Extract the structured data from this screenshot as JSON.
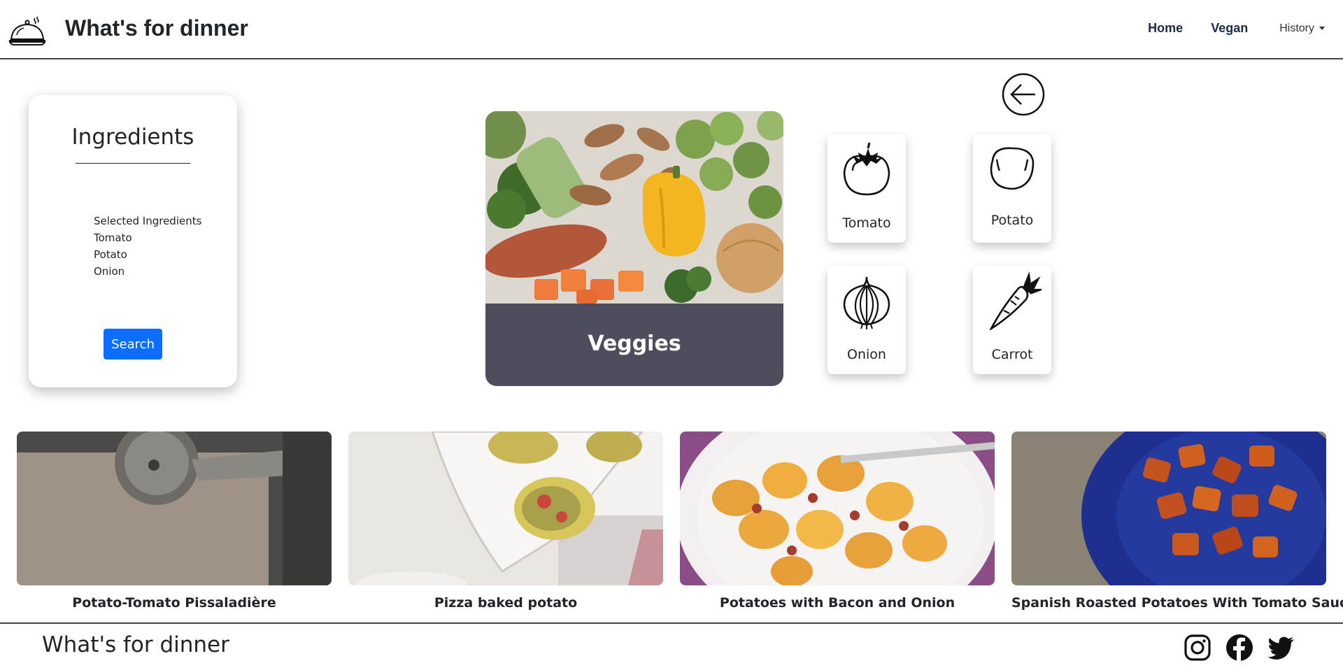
{
  "header": {
    "title": "What's for dinner",
    "logo_icon": "serving-dish-icon",
    "nav": {
      "home": "Home",
      "vegan": "Vegan",
      "history": "History"
    }
  },
  "ingredients_panel": {
    "title": "Ingredients",
    "selected_heading": "Selected Ingredients",
    "selected": [
      "Tomato",
      "Potato",
      "Onion"
    ],
    "search_label": "Search"
  },
  "category": {
    "label": "Veggies"
  },
  "back_icon": "arrow-left-circle-icon",
  "ingredient_tiles": [
    {
      "label": "Tomato",
      "icon": "tomato-icon"
    },
    {
      "label": "Potato",
      "icon": "potato-icon"
    },
    {
      "label": "Onion",
      "icon": "onion-icon"
    },
    {
      "label": "Carrot",
      "icon": "carrot-icon"
    }
  ],
  "recipes": [
    {
      "title": "Potato-Tomato Pissaladière"
    },
    {
      "title": "Pizza baked potato"
    },
    {
      "title": "Potatoes with Bacon and Onion"
    },
    {
      "title": "Spanish Roasted Potatoes With Tomato Sauce"
    }
  ],
  "footer": {
    "title": "What's for dinner",
    "social": [
      "instagram-icon",
      "facebook-icon",
      "twitter-icon"
    ]
  },
  "colors": {
    "primary_button": "#0d6efd",
    "category_band": "#4d4d5e",
    "nav_text": "#1c2a48"
  }
}
